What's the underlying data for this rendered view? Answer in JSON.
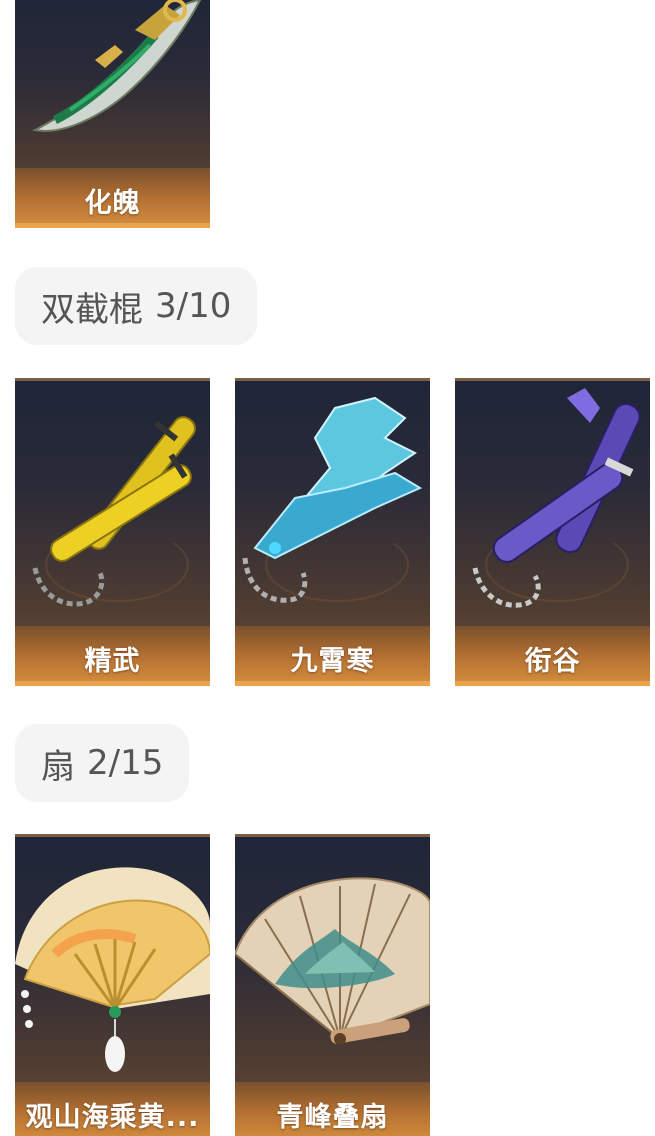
{
  "sections": [
    {
      "items": [
        {
          "label": "化魄",
          "icon": "green-gold-blade-icon"
        }
      ]
    },
    {
      "title": "双截棍",
      "count": "3/10",
      "items": [
        {
          "label": "精武",
          "icon": "yellow-nunchaku-icon"
        },
        {
          "label": "九霄寒",
          "icon": "ice-crystal-nunchaku-icon"
        },
        {
          "label": "衔谷",
          "icon": "purple-nunchaku-icon"
        }
      ]
    },
    {
      "title": "扇",
      "count": "2/15",
      "items": [
        {
          "label": "观山海乘黄...",
          "icon": "golden-painted-fan-icon"
        },
        {
          "label": "青峰叠扇",
          "icon": "landscape-folding-fan-icon"
        }
      ]
    }
  ],
  "colors": {
    "card_label_bar": "#b47032",
    "card_label_edge": "#e9a44d",
    "chip_background": "#f4f4f5",
    "chip_text": "#555555"
  }
}
